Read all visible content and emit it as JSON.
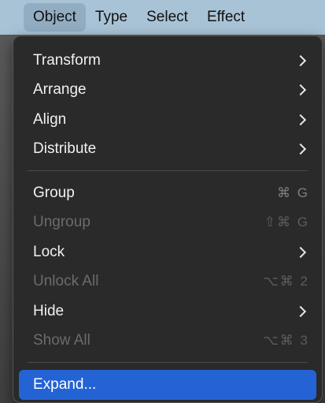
{
  "menubar": {
    "items": [
      {
        "label": "Object"
      },
      {
        "label": "Type"
      },
      {
        "label": "Select"
      },
      {
        "label": "Effect"
      }
    ]
  },
  "menu": {
    "items": [
      {
        "label": "Transform",
        "submenu": true,
        "enabled": true
      },
      {
        "label": "Arrange",
        "submenu": true,
        "enabled": true
      },
      {
        "label": "Align",
        "submenu": true,
        "enabled": true
      },
      {
        "label": "Distribute",
        "submenu": true,
        "enabled": true
      },
      {
        "label": "Group",
        "shortcut": "⌘ G",
        "enabled": true
      },
      {
        "label": "Ungroup",
        "shortcut": "⇧⌘ G",
        "enabled": false
      },
      {
        "label": "Lock",
        "submenu": true,
        "enabled": true
      },
      {
        "label": "Unlock All",
        "shortcut": "⌥⌘ 2",
        "enabled": false
      },
      {
        "label": "Hide",
        "submenu": true,
        "enabled": true
      },
      {
        "label": "Show All",
        "shortcut": "⌥⌘ 3",
        "enabled": false
      },
      {
        "label": "Expand...",
        "enabled": true,
        "highlighted": true
      }
    ]
  },
  "colors": {
    "menubar_bg": "#a9c3d6",
    "menubar_active": "#92adc2",
    "menu_bg": "#2a2a2a",
    "highlight": "#2463d4",
    "disabled_text": "#6b6b6b"
  }
}
